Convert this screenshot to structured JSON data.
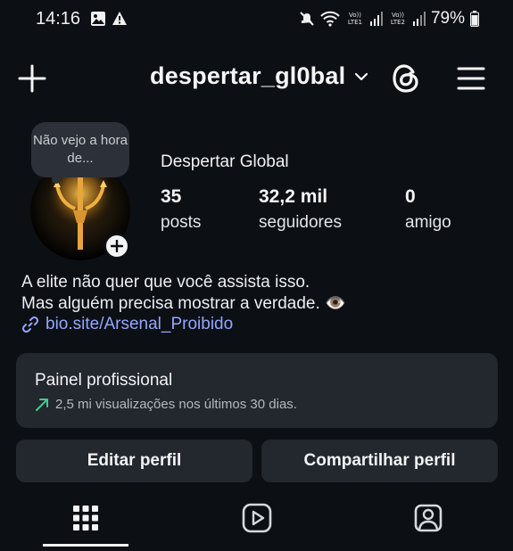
{
  "status_bar": {
    "time": "14:16",
    "lte1": "Vo)) LTE1",
    "lte2": "Vo)) LTE2",
    "battery": "79%",
    "icons": [
      "gallery-icon",
      "warning-icon",
      "mute-icon",
      "wifi-icon",
      "signal-icon",
      "battery-icon"
    ]
  },
  "header": {
    "username": "despertar_gl0bal",
    "icons": [
      "plus-icon",
      "chevron-down-icon",
      "threads-icon",
      "menu-icon"
    ]
  },
  "profile": {
    "note": "Não vejo a hora de...",
    "display_name": "Despertar Global",
    "stats": [
      {
        "value": "35",
        "label": "posts"
      },
      {
        "value": "32,2 mil",
        "label": "seguidores"
      },
      {
        "value": "0",
        "label": "amigo"
      }
    ],
    "bio_line1": "A elite não quer que você assista isso.",
    "bio_line2": "Mas alguém precisa mostrar a verdade. 👁️",
    "link": "bio.site/Arsenal_Proibido"
  },
  "dashboard": {
    "title": "Painel profissional",
    "subtitle": "2,5 mi visualizações nos últimos 30 dias."
  },
  "buttons": {
    "edit_profile": "Editar perfil",
    "share_profile": "Compartilhar perfil"
  },
  "tabs": [
    "grid-icon",
    "reels-icon",
    "tagged-icon"
  ],
  "colors": {
    "background": "#0c0f14",
    "surface": "#23272e",
    "link": "#93a7ff",
    "trend": "#3ecf8e"
  }
}
